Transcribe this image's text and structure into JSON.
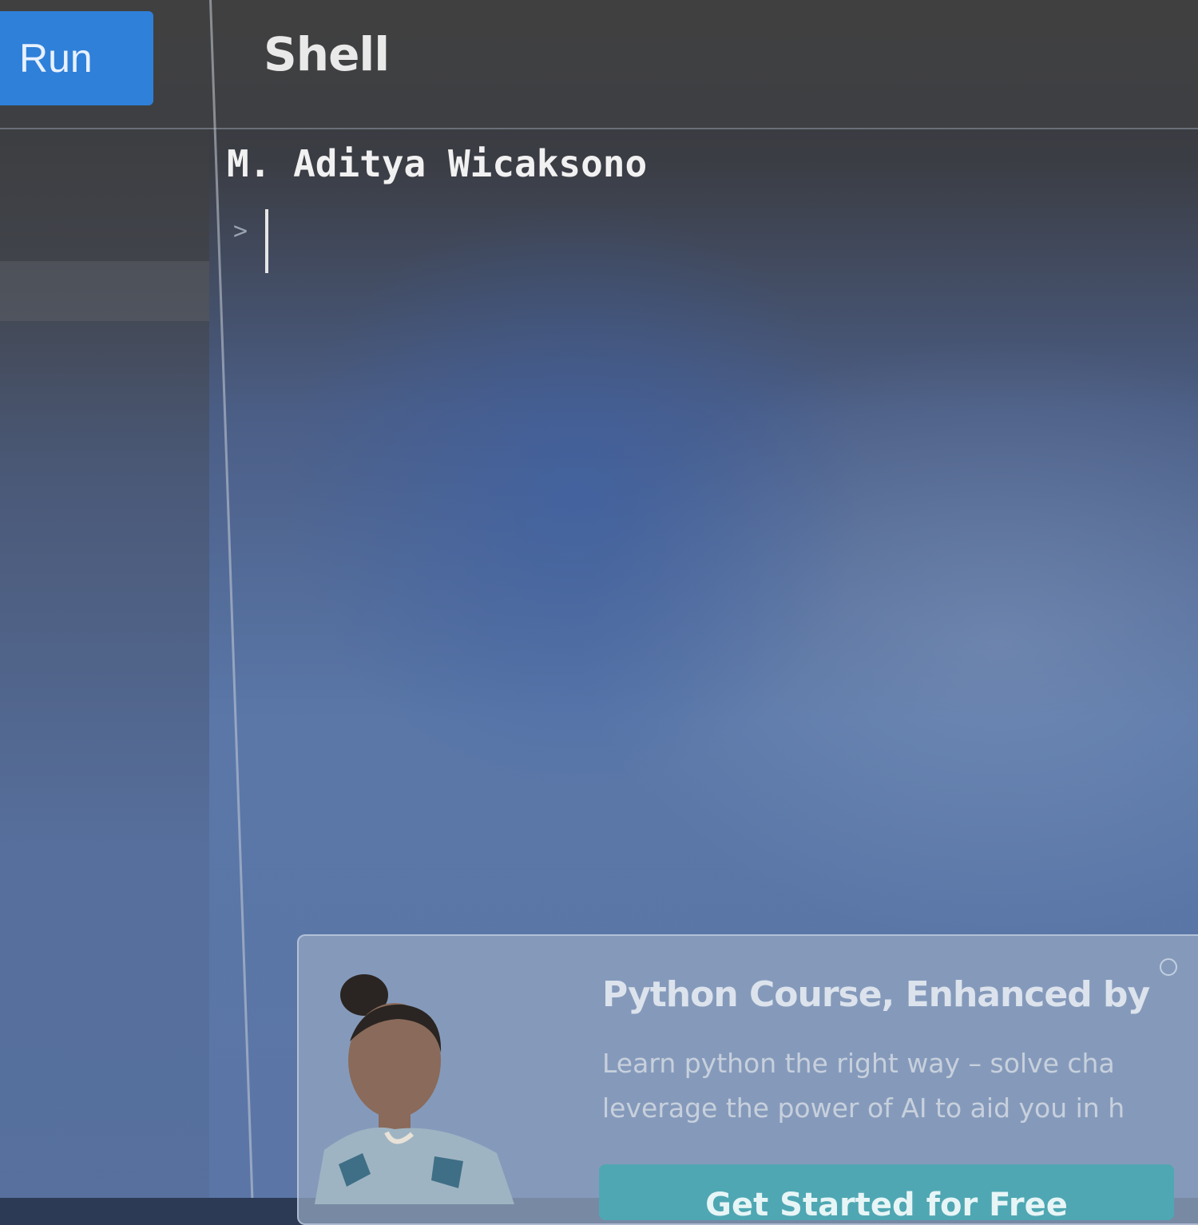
{
  "toolbar": {
    "run_label": "Run",
    "shell_tab_label": "Shell"
  },
  "console": {
    "output": "M. Aditya Wicaksono",
    "prompt_symbol": ">"
  },
  "promo": {
    "title": "Python Course, Enhanced by",
    "text": "Learn python the right way – solve cha\nleverage the power of AI to aid you in h",
    "cta_label": "Get Started for Free"
  },
  "colors": {
    "run_button": "#2f80d9",
    "promo_cta": "#4fa7b3"
  }
}
